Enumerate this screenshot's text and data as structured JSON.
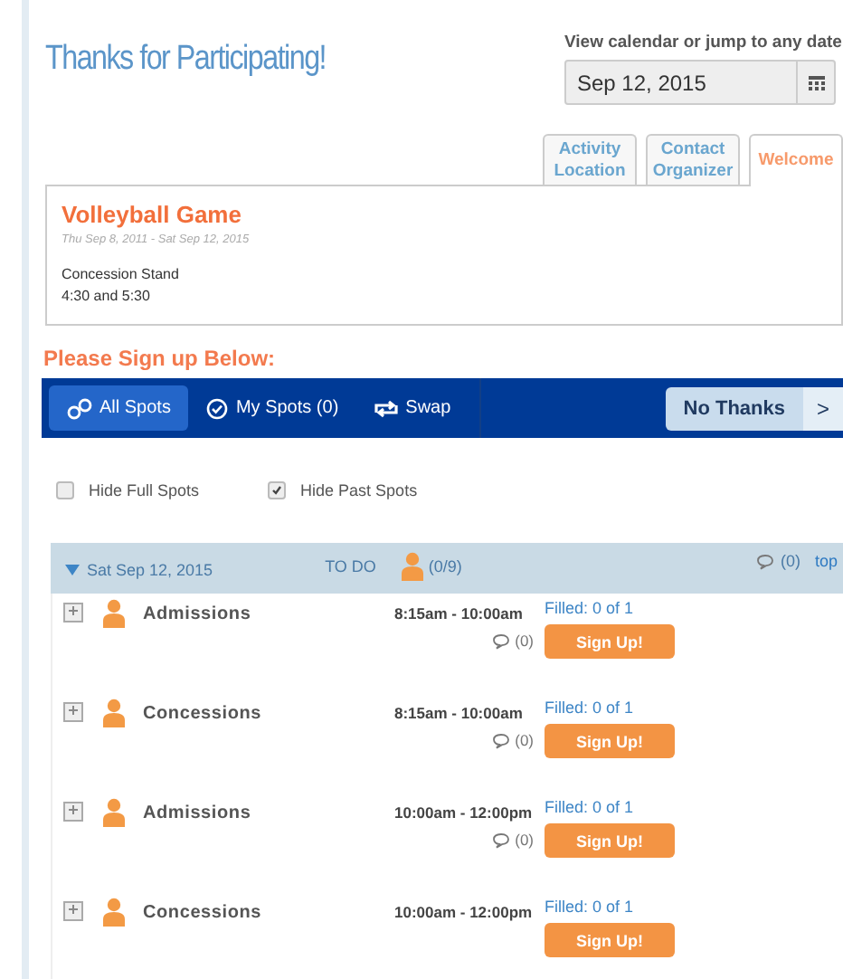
{
  "title": "Thanks for Participating!",
  "date_picker": {
    "label": "View calendar or jump to any date",
    "value": "Sep 12, 2015"
  },
  "tabs": [
    {
      "label": "Activity Location",
      "selected": false
    },
    {
      "label": "Contact Organizer",
      "selected": false
    },
    {
      "label": "Welcome",
      "selected": true
    }
  ],
  "event": {
    "name": "Volleyball Game",
    "dates": "Thu Sep 8, 2011 - Sat Sep 12, 2015",
    "description": [
      "Concession Stand",
      "4:30 and 5:30"
    ]
  },
  "signup_heading": "Please Sign up Below:",
  "toolbar": {
    "buttons": [
      {
        "kind": "all",
        "label": "All Spots",
        "selected": true
      },
      {
        "kind": "mine",
        "label": "My Spots (0)",
        "selected": false
      },
      {
        "kind": "swap",
        "label": "Swap",
        "selected": false
      }
    ],
    "decline": "No Thanks",
    "next": ">"
  },
  "filters": [
    {
      "label": "Hide Full Spots",
      "checked": false
    },
    {
      "label": "Hide Past Spots",
      "checked": true
    }
  ],
  "day": {
    "date": "Sat Sep 12, 2015",
    "expanded": true,
    "todo": "TO DO",
    "todo_count": "(0/9)",
    "comments": "(0)",
    "top_link": "top"
  },
  "slots": [
    {
      "name": "Admissions",
      "time": "8:15am - 10:00am",
      "comments": "(0)",
      "filled": "Filled: 0 of 1",
      "action": "Sign Up!"
    },
    {
      "name": "Concessions",
      "time": "8:15am - 10:00am",
      "comments": "(0)",
      "filled": "Filled: 0 of 1",
      "action": "Sign Up!"
    },
    {
      "name": "Admissions",
      "time": "10:00am - 12:00pm",
      "comments": "(0)",
      "filled": "Filled: 0 of 1",
      "action": "Sign Up!"
    },
    {
      "name": "Concessions",
      "time": "10:00am - 12:00pm",
      "filled": "Filled: 0 of 1",
      "action": "Sign Up!"
    }
  ]
}
